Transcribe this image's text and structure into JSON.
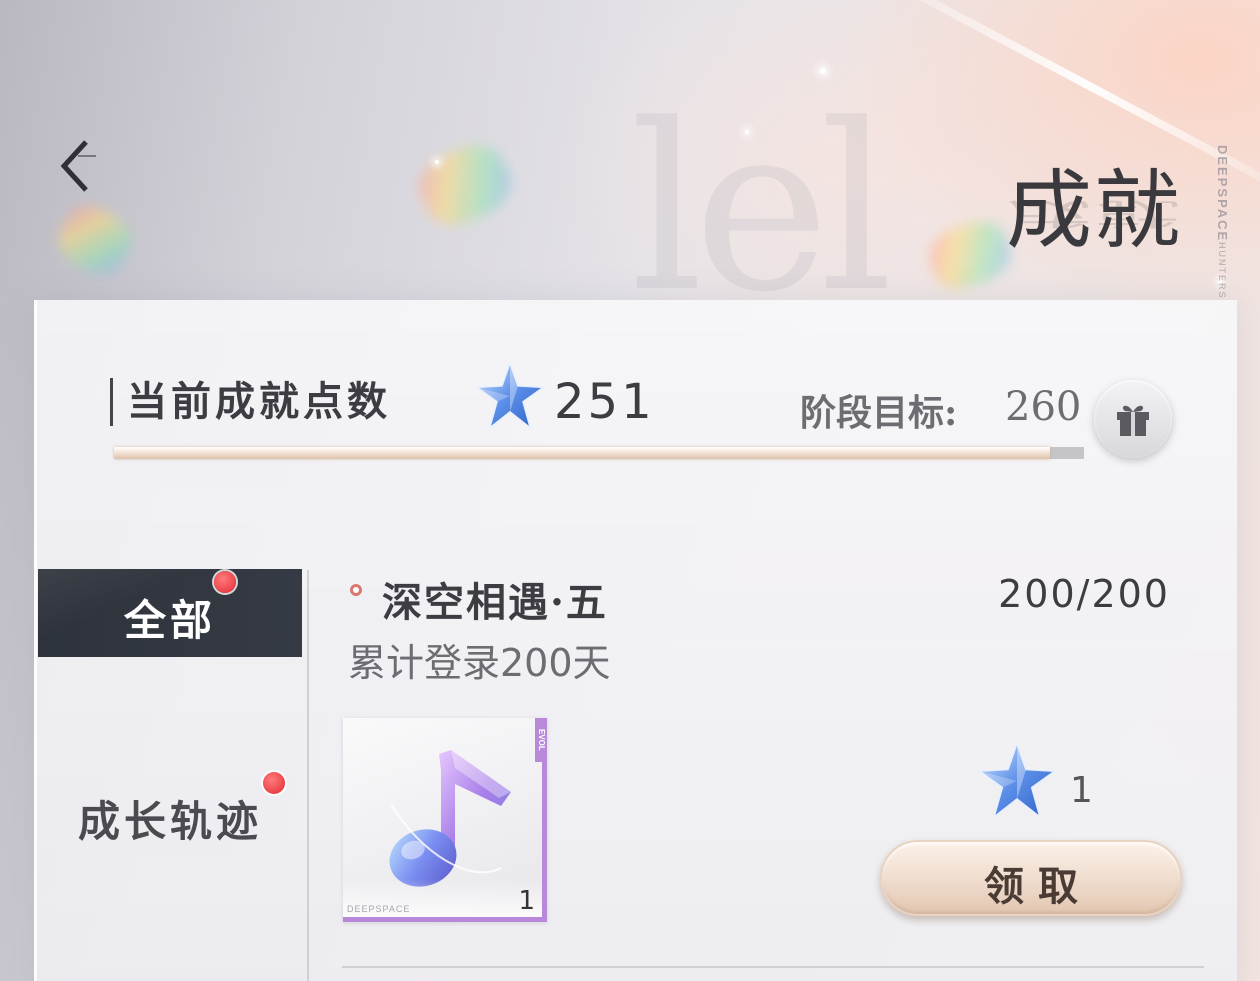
{
  "header": {
    "title": "成就",
    "brand": "DEEPSPACE",
    "brand_sub": "HUNTERS"
  },
  "points": {
    "label": "当前成就点数",
    "value": "251",
    "goal_label": "阶段目标:",
    "goal_value": "260",
    "progress_fraction": 0.965
  },
  "tabs": [
    {
      "label": "全部",
      "selected": true,
      "has_notification": true
    },
    {
      "label": "成长轨迹",
      "selected": false,
      "has_notification": true
    }
  ],
  "achievement": {
    "title": "深空相遇·五",
    "progress": "200/200",
    "description": "累计登录200天",
    "item": {
      "icon": "music-note-icon",
      "quantity": "1",
      "tag": "EVOL",
      "brand": "DEEPSPACE",
      "rarity_color": "#b889d8"
    },
    "reward_points": "1",
    "claim_label": "领取"
  },
  "colors": {
    "accent_progress": "#dcc3ad",
    "notification_red": "#e22a35",
    "selected_tab": "#2e333b",
    "star_blue": "#4f7fe0"
  }
}
